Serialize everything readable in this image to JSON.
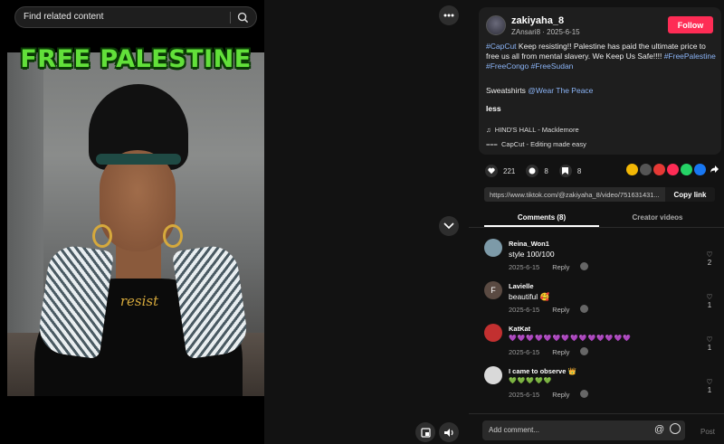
{
  "search": {
    "placeholder": "Find related content"
  },
  "video": {
    "overlay_title": "FREE PALESTINE",
    "necklace_text": "resist"
  },
  "post": {
    "username": "zakiyaha_8",
    "subline": "ZAnsari8 · 2025-6-15",
    "follow_label": "Follow",
    "caption_tag1": "#CapCut",
    "caption_body": " Keep resisting!! Palestine has paid the ultimate price to free us all from mental slavery. We Keep Us Safe!!!! ",
    "caption_tags": "#FreePalestine #FreeCongo #FreeSudan",
    "sweatshirts_prefix": "Sweatshirts ",
    "sweatshirts_link": "@Wear The Peace",
    "less_label": "less",
    "music": "HIND'S HALL - Macklemore",
    "capcut": "CapCut - Editing made easy"
  },
  "stats": {
    "likes": "221",
    "comments": "8",
    "saves": "8"
  },
  "share_colors": [
    "#f2b705",
    "#555555",
    "#e53935",
    "#fe2c55",
    "#25d366",
    "#1877f2"
  ],
  "link": {
    "url": "https://www.tiktok.com/@zakiyaha_8/video/751631431...",
    "copy_label": "Copy link"
  },
  "tabs": {
    "comments": "Comments (8)",
    "creator_videos": "Creator videos"
  },
  "comments": [
    {
      "name": "Reina_Won1",
      "text": "style 100/100",
      "date": "2025-6-15",
      "reply": "Reply",
      "likes": "2",
      "avatar_color": "#7d9aa8"
    },
    {
      "name": "Lavielle",
      "text": "beautiful 🥰",
      "date": "2025-6-15",
      "reply": "Reply",
      "likes": "1",
      "avatar_color": "#5a4a42",
      "avatar_letter": "F"
    },
    {
      "name": "KatKat",
      "text": "💜💜💜💜💜💜💜💜💜💜💜💜💜💜",
      "date": "2025-6-15",
      "reply": "Reply",
      "likes": "1",
      "avatar_color": "#c23030"
    },
    {
      "name": "I came to observe 👑",
      "text": "💚💚💚💚💚",
      "date": "2025-6-15",
      "reply": "Reply",
      "likes": "1",
      "avatar_color": "#d9d9d9"
    }
  ],
  "comment_bar": {
    "placeholder": "Add comment...",
    "at": "@",
    "post_label": "Post"
  }
}
